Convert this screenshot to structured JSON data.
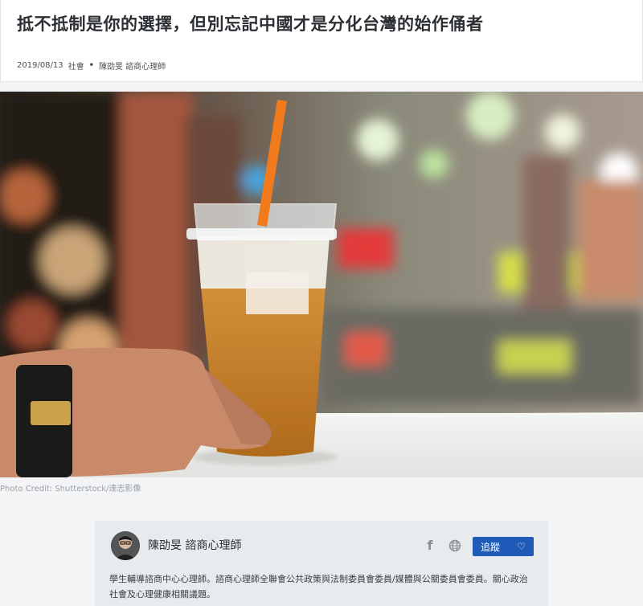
{
  "article": {
    "title": "抵不抵制是你的選擇，但別忘記中國才是分化台灣的始作俑者",
    "date": "2019/08/13",
    "category": "社會",
    "separator": "•",
    "author_byline": "陳劭旻 諮商心理師"
  },
  "photo": {
    "credit": "Photo Credit: Shutterstock/達志影像"
  },
  "author_card": {
    "name": "陳劭旻 諮商心理師",
    "follow_label": "追蹤",
    "heart_glyph": "♡",
    "facebook_glyph": "f",
    "bio": "學生輔導諮商中心心理師。諮商心理師全聯會公共政策與法制委員會委員/媒體與公關委員會委員。關心政治社會及心理健康相關議題。"
  },
  "colors": {
    "accent": "#1e5bb8",
    "straw": "#f07a1c",
    "drink": "#c97f2a"
  }
}
